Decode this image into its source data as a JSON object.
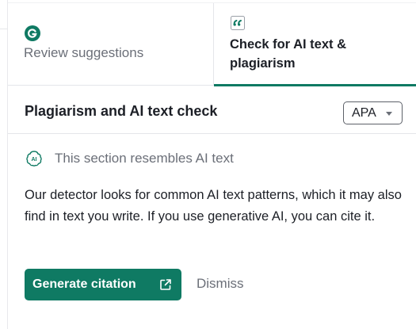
{
  "tabs": [
    {
      "label": "Review suggestions",
      "icon": "grammarly-logo-icon",
      "active": false
    },
    {
      "label": "Check for AI text & plagiarism",
      "icon": "quote-icon",
      "active": true
    }
  ],
  "header": {
    "title": "Plagiarism and AI text check",
    "citation_style": "APA"
  },
  "ai_notice": {
    "icon": "ai-brain-icon",
    "text": "This section resembles AI text"
  },
  "description": "Our detector looks for common AI text patterns, which it may also find in text you write. If you use generative AI, you can cite it.",
  "actions": {
    "generate_label": "Generate citation",
    "dismiss_label": "Dismiss"
  },
  "colors": {
    "accent": "#0f7a63",
    "muted_text": "#6b6f78",
    "text": "#1c1f26"
  }
}
